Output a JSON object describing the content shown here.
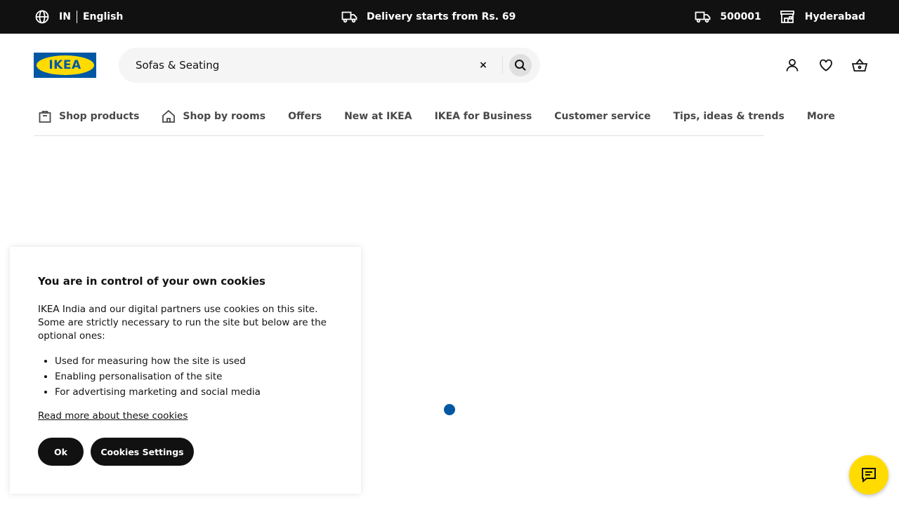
{
  "topbar": {
    "country": "IN",
    "language": "English",
    "delivery_text": "Delivery starts from Rs. 69",
    "pincode": "500001",
    "store": "Hyderabad"
  },
  "header": {
    "logo_text": "IKEA",
    "search": {
      "value": "Sofas & Seating",
      "clear_label": "×"
    }
  },
  "nav": {
    "items": [
      {
        "label": "Shop products",
        "icon": "bag-icon"
      },
      {
        "label": "Shop by rooms",
        "icon": "house-icon"
      },
      {
        "label": "Offers"
      },
      {
        "label": "New at IKEA"
      },
      {
        "label": "IKEA for Business"
      },
      {
        "label": "Customer service"
      },
      {
        "label": "Tips, ideas & trends"
      },
      {
        "label": "More"
      }
    ]
  },
  "cookie_banner": {
    "title": "You are in control of your own cookies",
    "description": "IKEA India and our digital partners use cookies on this site. Some are strictly necessary to run the site but below are the optional ones:",
    "bullets": [
      "Used for measuring how the site is used",
      "Enabling personalisation of the site",
      "For advertising marketing and social media"
    ],
    "read_more": "Read more about these cookies",
    "ok_label": "Ok",
    "settings_label": "Cookies Settings"
  },
  "colors": {
    "brand_blue": "#0058a3",
    "brand_yellow": "#ffdb00",
    "topbar_bg": "#111111"
  }
}
